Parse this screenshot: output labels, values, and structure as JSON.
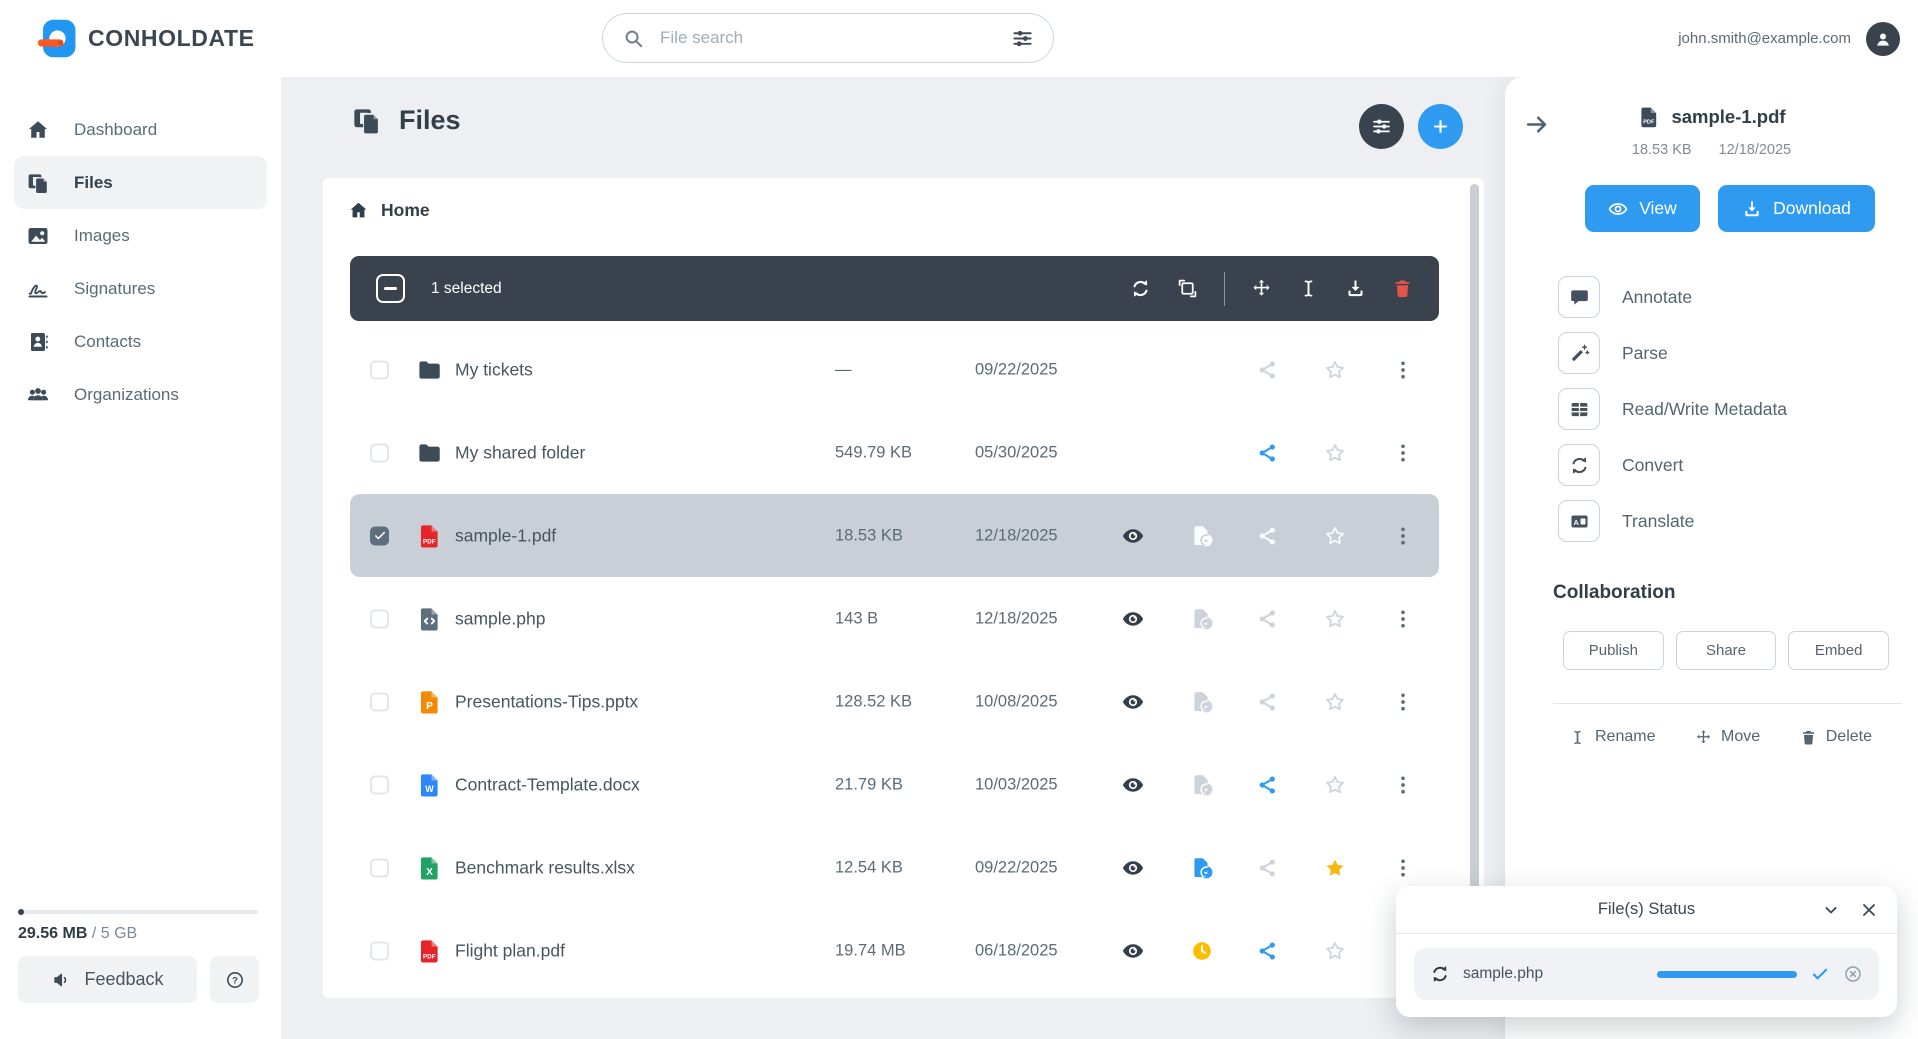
{
  "topbar": {
    "brand": "CONHOLDATE",
    "search_placeholder": "File search",
    "user_email": "john.smith@example.com"
  },
  "sidebar": {
    "items": [
      {
        "label": "Dashboard",
        "icon": "home",
        "active": false
      },
      {
        "label": "Files",
        "icon": "files",
        "active": true
      },
      {
        "label": "Images",
        "icon": "image",
        "active": false
      },
      {
        "label": "Signatures",
        "icon": "sign",
        "active": false
      },
      {
        "label": "Contacts",
        "icon": "contacts",
        "active": false
      },
      {
        "label": "Organizations",
        "icon": "people",
        "active": false
      }
    ],
    "storage": {
      "used": "29.56 MB",
      "separator": " / ",
      "total": "5 GB",
      "used_percent": 0.6
    },
    "feedback_label": "Feedback"
  },
  "main": {
    "title": "Files",
    "breadcrumb": "Home",
    "toolbar": {
      "selected_text": "1 selected",
      "icons": [
        {
          "icon": "refresh"
        },
        {
          "icon": "transform"
        },
        {
          "divider": true
        },
        {
          "icon": "move"
        },
        {
          "icon": "ibeam"
        },
        {
          "icon": "download"
        },
        {
          "icon": "trash",
          "red": true
        }
      ]
    },
    "files": {
      "rows": [
        {
          "name": "My tickets",
          "type": "folder",
          "size": "—",
          "date": "09/22/2025",
          "selected": false,
          "checked": false,
          "eye": false,
          "doc": "none",
          "share": "gray",
          "star": "gray"
        },
        {
          "name": "My shared folder",
          "type": "folder",
          "size": "549.79 KB",
          "date": "05/30/2025",
          "selected": false,
          "checked": false,
          "eye": false,
          "doc": "none",
          "share": "blue",
          "star": "gray"
        },
        {
          "name": "sample-1.pdf",
          "type": "pdf",
          "size": "18.53 KB",
          "date": "12/18/2025",
          "selected": true,
          "checked": true,
          "eye": true,
          "doc": "white",
          "share": "white",
          "star": "white"
        },
        {
          "name": "sample.php",
          "type": "php",
          "size": "143 B",
          "date": "12/18/2025",
          "selected": false,
          "checked": false,
          "eye": true,
          "doc": "gray",
          "share": "gray",
          "star": "gray"
        },
        {
          "name": "Presentations-Tips.pptx",
          "type": "pptx",
          "size": "128.52 KB",
          "date": "10/08/2025",
          "selected": false,
          "checked": false,
          "eye": true,
          "doc": "gray",
          "share": "gray",
          "star": "gray"
        },
        {
          "name": "Contract-Template.docx",
          "type": "docx",
          "size": "21.79 KB",
          "date": "10/03/2025",
          "selected": false,
          "checked": false,
          "eye": true,
          "doc": "gray",
          "share": "blue",
          "star": "gray"
        },
        {
          "name": "Benchmark results.xlsx",
          "type": "xlsx",
          "size": "12.54 KB",
          "date": "09/22/2025",
          "selected": false,
          "checked": false,
          "eye": true,
          "doc": "blue",
          "share": "gray",
          "star": "yellow"
        },
        {
          "name": "Flight plan.pdf",
          "type": "pdf",
          "size": "19.74 MB",
          "date": "06/18/2025",
          "selected": false,
          "checked": false,
          "eye": true,
          "doc": "clock",
          "share": "blue",
          "star": "gray"
        }
      ]
    }
  },
  "details": {
    "file_name": "sample-1.pdf",
    "file_size": "18.53 KB",
    "file_date": "12/18/2025",
    "view_label": "View",
    "download_label": "Download",
    "actions": [
      {
        "label": "Annotate",
        "icon": "chat"
      },
      {
        "label": "Parse",
        "icon": "wand"
      },
      {
        "label": "Read/Write Metadata",
        "icon": "table"
      },
      {
        "label": "Convert",
        "icon": "refresh"
      },
      {
        "label": "Translate",
        "icon": "translate"
      }
    ],
    "collaboration": {
      "title": "Collaboration",
      "buttons": [
        "Publish",
        "Share",
        "Embed"
      ]
    },
    "file_ops": [
      {
        "label": "Rename",
        "icon": "ibeam"
      },
      {
        "label": "Move",
        "icon": "move"
      },
      {
        "label": "Delete",
        "icon": "trash"
      }
    ]
  },
  "status_panel": {
    "title": "File(s) Status",
    "items": [
      {
        "name": "sample.php",
        "progress": 100
      }
    ]
  },
  "colors": {
    "accent_blue": "#2e9af0",
    "dark_slate": "#39434d",
    "selected_row": "#c9cfd6",
    "danger_red": "#e25349",
    "star_yellow": "#f8b70d",
    "clock_yellow": "#fcbd00",
    "pdf_red": "#e5252a",
    "pptx_orange": "#ef8b06",
    "docx_blue": "#2f86f6",
    "xlsx_green": "#21a366"
  }
}
